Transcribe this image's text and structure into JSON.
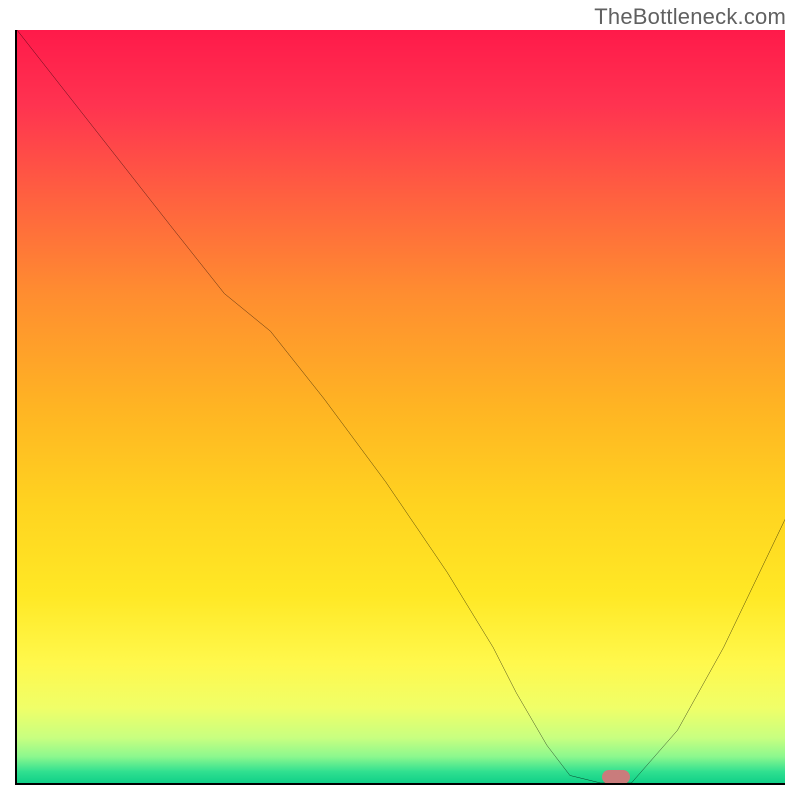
{
  "watermark": "TheBottleneck.com",
  "chart_data": {
    "type": "line",
    "title": "",
    "xlabel": "",
    "ylabel": "",
    "xlim": [
      0,
      100
    ],
    "ylim": [
      0,
      100
    ],
    "grid": false,
    "legend": false,
    "series": [
      {
        "name": "bottleneck-curve",
        "x": [
          0,
          10,
          20,
          27,
          33,
          40,
          48,
          56,
          62,
          65,
          69,
          72,
          76,
          80,
          86,
          92,
          100
        ],
        "y": [
          100,
          87,
          74,
          65,
          60,
          51,
          40,
          28,
          18,
          12,
          5,
          1,
          0,
          0,
          7,
          18,
          35
        ],
        "color": "#000000"
      }
    ],
    "marker": {
      "x": 78,
      "y": 0,
      "color": "#c97c7c"
    },
    "background_gradient": {
      "stops": [
        {
          "offset": 0.0,
          "color": "#ff1a4a"
        },
        {
          "offset": 0.1,
          "color": "#ff3350"
        },
        {
          "offset": 0.22,
          "color": "#ff6040"
        },
        {
          "offset": 0.35,
          "color": "#ff8d30"
        },
        {
          "offset": 0.5,
          "color": "#ffb423"
        },
        {
          "offset": 0.63,
          "color": "#ffd320"
        },
        {
          "offset": 0.75,
          "color": "#ffe825"
        },
        {
          "offset": 0.84,
          "color": "#fff84c"
        },
        {
          "offset": 0.9,
          "color": "#f0ff68"
        },
        {
          "offset": 0.94,
          "color": "#c8ff80"
        },
        {
          "offset": 0.965,
          "color": "#8cf88e"
        },
        {
          "offset": 0.985,
          "color": "#30e090"
        },
        {
          "offset": 1.0,
          "color": "#10d088"
        }
      ]
    }
  }
}
